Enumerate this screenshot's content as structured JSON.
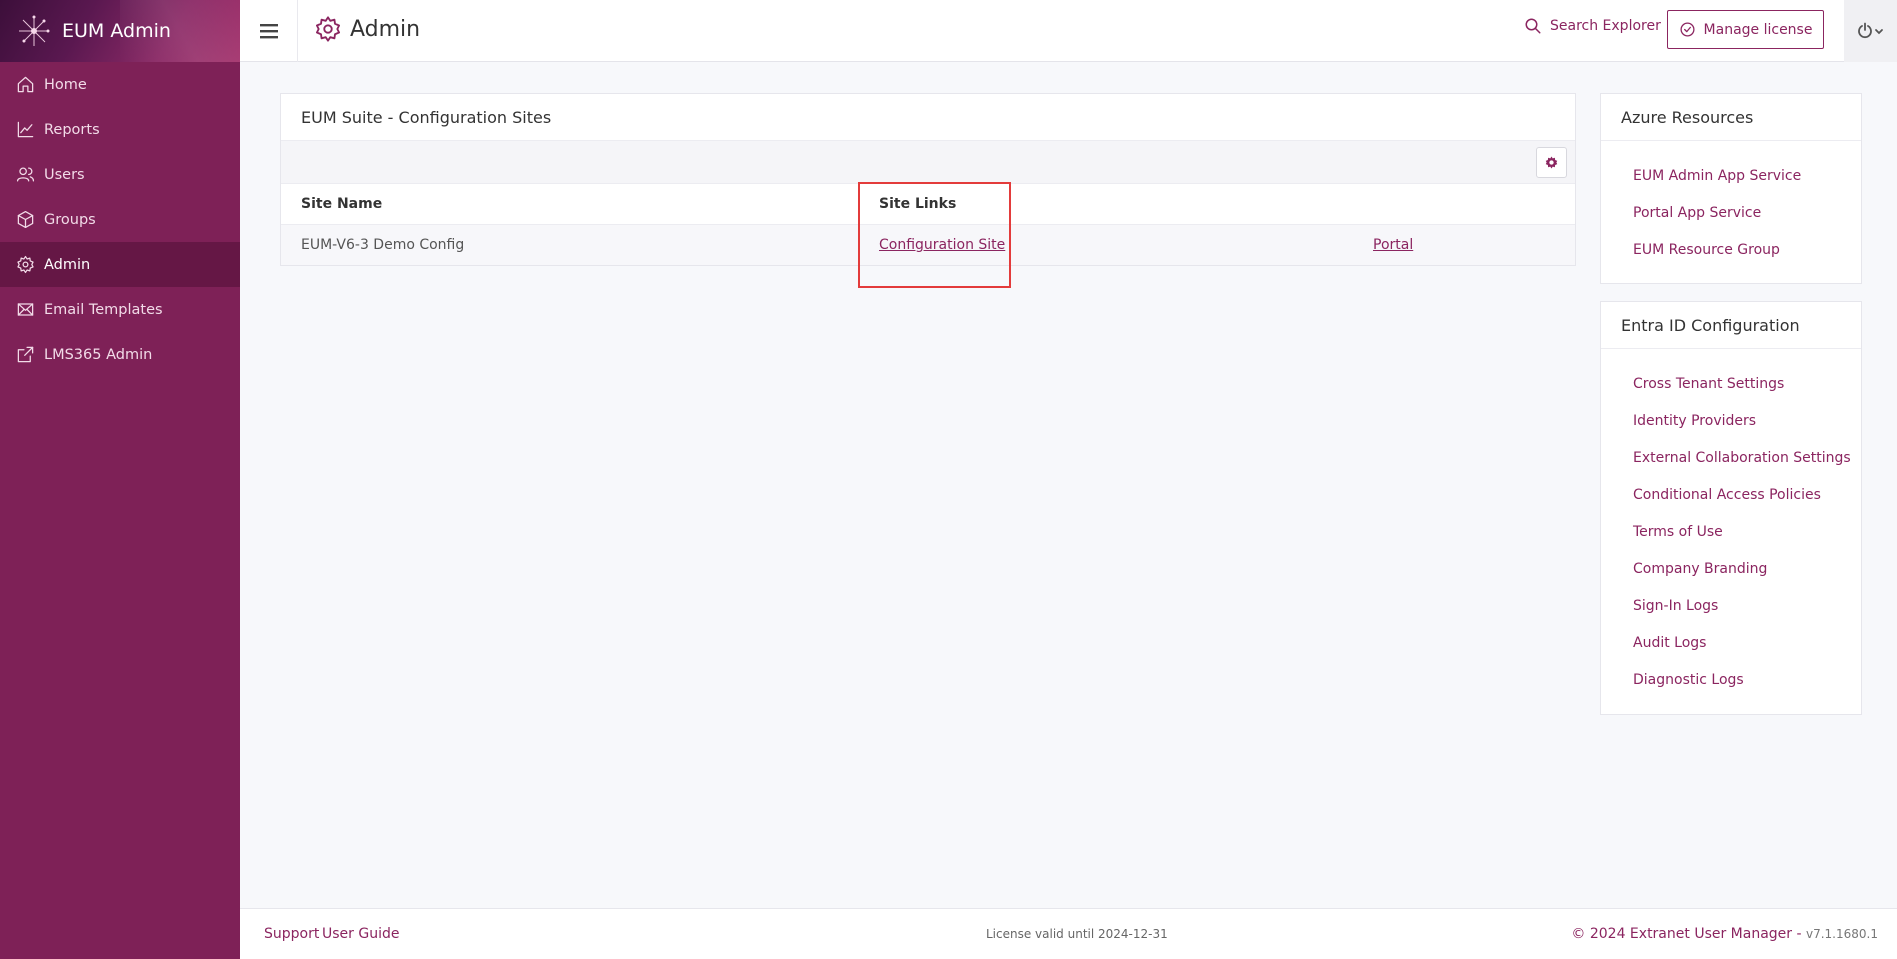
{
  "app": {
    "title": "EUM Admin"
  },
  "sidebar": {
    "items": [
      {
        "label": "Home",
        "icon": "home-icon"
      },
      {
        "label": "Reports",
        "icon": "chart-line-icon"
      },
      {
        "label": "Users",
        "icon": "users-icon"
      },
      {
        "label": "Groups",
        "icon": "cube-icon"
      },
      {
        "label": "Admin",
        "icon": "gear-icon",
        "active": true
      },
      {
        "label": "Email Templates",
        "icon": "envelope-icon"
      },
      {
        "label": "LMS365 Admin",
        "icon": "external-link-icon"
      }
    ]
  },
  "header": {
    "title": "Admin",
    "search_label": "Search Explorer",
    "manage_label": "Manage license"
  },
  "main": {
    "card_title": "EUM Suite - Configuration Sites",
    "columns": [
      "Site Name",
      "Site Links"
    ],
    "rows": [
      {
        "site_name": "EUM-V6-3 Demo Config",
        "link1": "Configuration Site",
        "link2": "Portal"
      }
    ]
  },
  "azure": {
    "title": "Azure Resources",
    "items": [
      "EUM Admin App Service",
      "Portal App Service",
      "EUM Resource Group"
    ]
  },
  "entra": {
    "title": "Entra ID Configuration",
    "items": [
      "Cross Tenant Settings",
      "Identity Providers",
      "External Collaboration Settings",
      "Conditional Access Policies",
      "Terms of Use",
      "Company Branding",
      "Sign-In Logs",
      "Audit Logs",
      "Diagnostic Logs"
    ]
  },
  "footer": {
    "support": "Support",
    "guide": "User Guide",
    "license": "License valid until 2024-12-31",
    "copyright": "© 2024 Extranet User Manager - ",
    "version": "v7.1.1680.1"
  },
  "colors": {
    "accent": "#8b2560",
    "sidebar": "#7e2157",
    "highlight": "#e33b3b"
  }
}
